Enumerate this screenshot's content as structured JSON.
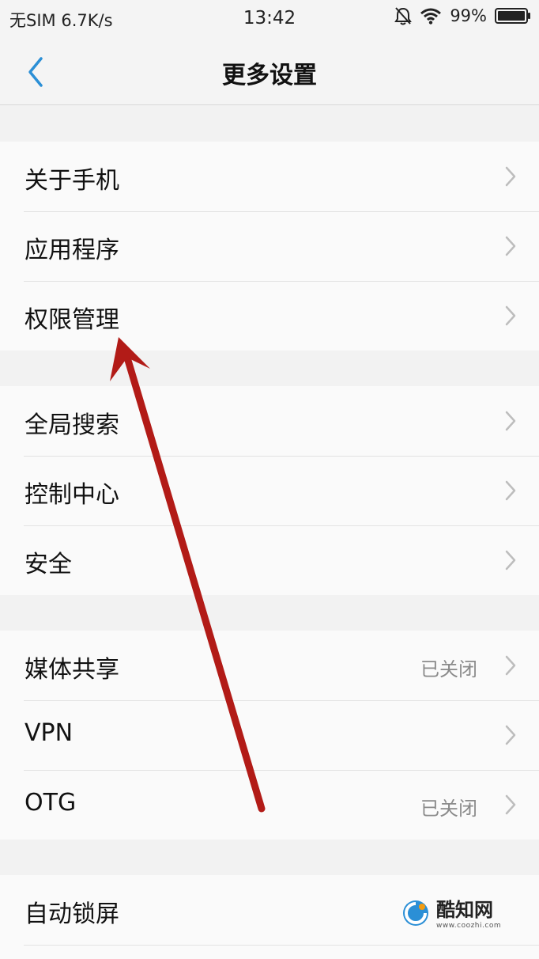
{
  "status_bar": {
    "carrier": "无SIM",
    "speed": "6.7K/s",
    "time": "13:42",
    "battery": "99%"
  },
  "nav": {
    "back_icon": "chevron-left-icon",
    "title": "更多设置"
  },
  "groups": [
    {
      "items": [
        {
          "label": "关于手机",
          "value": ""
        },
        {
          "label": "应用程序",
          "value": ""
        },
        {
          "label": "权限管理",
          "value": ""
        }
      ]
    },
    {
      "items": [
        {
          "label": "全局搜索",
          "value": ""
        },
        {
          "label": "控制中心",
          "value": ""
        },
        {
          "label": "安全",
          "value": ""
        }
      ]
    },
    {
      "items": [
        {
          "label": "媒体共享",
          "value": "已关闭"
        },
        {
          "label": "VPN",
          "value": ""
        },
        {
          "label": "OTG",
          "value": "已关闭"
        }
      ]
    },
    {
      "items": [
        {
          "label": "自动锁屏",
          "value": ""
        }
      ]
    }
  ],
  "watermark": {
    "name": "酷知网",
    "url": "www.coozhi.com"
  },
  "colors": {
    "accent": "#2b8fd6",
    "annotation": "#b21b17",
    "chevron": "#bdbdbd"
  }
}
